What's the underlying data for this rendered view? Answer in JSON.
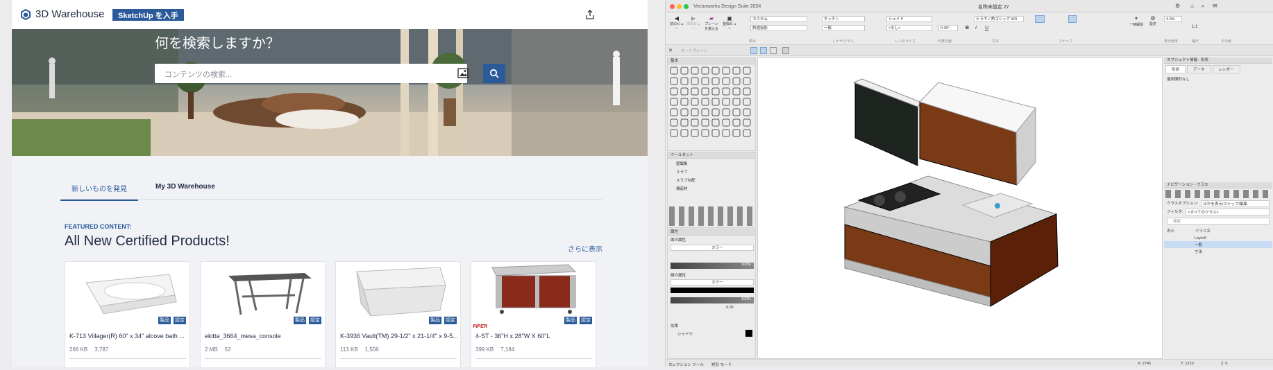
{
  "warehouse": {
    "logo": "3D Warehouse",
    "cta": "SketchUp を入手",
    "hero_title": "何を検索しますか？",
    "search_placeholder": "コンテンツの検索...",
    "tabs": [
      "新しいものを発見",
      "My 3D Warehouse"
    ],
    "featured_label": "FEATURED CONTENT:",
    "featured_title": "All New Certified Products!",
    "more_link": "さらに表示",
    "badges": [
      "製品",
      "認定"
    ],
    "cards": [
      {
        "title": "K-713 Villager(R) 60\" x 34\" alcove bath ...",
        "size": "266 KB",
        "views": "3,787"
      },
      {
        "title": "ekitta_3664_mesa_console",
        "size": "2 MB",
        "views": "52"
      },
      {
        "title": "K-3936 Vault(TM) 29-1/2\" x 21-1/4\" x 9-5...",
        "size": "113 KB",
        "views": "1,506"
      },
      {
        "title": "4-ST - 36\"H x 28\"W X 60\"L",
        "size": "399 KB",
        "views": "7,184",
        "brand": "PIPER"
      }
    ],
    "colors": {
      "accent": "#2a5a9a",
      "text": "#1f2a44"
    }
  },
  "vectorworks": {
    "app_title": "Vectorworks Design Suite 2024",
    "doc_title": "名称未設定 27",
    "toolbar": {
      "btn_prev_view": "前のビュー",
      "btn_next_view": "次のビュー",
      "btn_plane": "プレーンを揃える",
      "btn_saved_view": "登録ビュー",
      "btn_unify": "一時解除",
      "btn_settings": "設定",
      "sel_custom": "カスタム",
      "sel_projection": "斜透投影",
      "sel_class": "キッチン",
      "sel_layer": "一般",
      "sel_render": "シェイド",
      "sel_plane": "<なし>",
      "font": "ヒラギノ角ゴシック W3",
      "angle": "0.00°",
      "zoom": "4.9%",
      "scale": "1:1",
      "section_view": "表示",
      "section_layer": "レイヤ/クラス",
      "section_render": "レンダライズ",
      "section_plane": "作業平面",
      "section_text": "文字",
      "section_snap": "スナップ",
      "section_zoom": "表示倍率",
      "section_scale": "縮尺",
      "section_other": "その他"
    },
    "row2_label": "オートプレーン",
    "palettes": {
      "basic": "基本",
      "toolset": "ツールセット",
      "toolset_items": [
        "壁編集",
        "スラブ",
        "スラブ勾配",
        "構造材"
      ],
      "attributes": "属性",
      "fill_label": "面の属性",
      "fill_type": "カラー",
      "fill_opacity": "100%",
      "line_label": "線の属性",
      "line_type": "カラー",
      "line_opacity": "100%",
      "line_weight": "0.05",
      "effects": "効果",
      "shadow": "シャドウ"
    },
    "obj_info": {
      "title": "オブジェクト情報 - 形状",
      "tabs": [
        "形状",
        "データ",
        "レンダー"
      ],
      "selection": "選択図形なし"
    },
    "nav": {
      "title": "ナビゲーション - クラス",
      "class_option_label": "クラスオプション:",
      "class_option_value": "ほかを表示/スナップ/編集",
      "filter_label": "フィルタ:",
      "filter_value": "<すべてのクラス>",
      "search": "検索",
      "header_vis": "表示",
      "header_name": "クラス名",
      "classes": [
        "Layer0",
        "一般",
        "寸法"
      ]
    },
    "status": {
      "tool": "セレクション ツール",
      "mode": "矩形 モード",
      "x": "X: 2745",
      "y": "Y: 1210",
      "z": "Z: 0"
    }
  }
}
